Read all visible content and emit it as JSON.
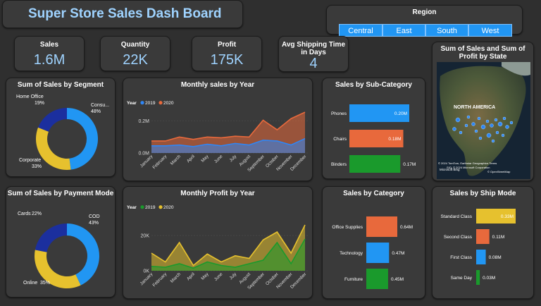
{
  "header": {
    "title": "Super Store Sales Dash Board"
  },
  "region": {
    "title": "Region",
    "options": [
      "Central",
      "East",
      "South",
      "West"
    ]
  },
  "kpis": [
    {
      "label": "Sales",
      "value": "1.6M"
    },
    {
      "label": "Quantity",
      "value": "22K"
    },
    {
      "label": "Profit",
      "value": "175K"
    },
    {
      "label": "Avg Shipping Time in Days",
      "value": "4"
    }
  ],
  "map": {
    "title": "Sum of Sales and Sum of Profit by State",
    "region_label": "NORTH AMERICA",
    "credit1": "© 2024 TomTom, Earthstar Geographics  Terms",
    "credit2": "SIO, © 2024 Microsoft Corporation",
    "credit3": "© OpenStreetMap",
    "brand": "Microsoft Bing"
  },
  "colors": {
    "blue": "#2196f3",
    "orange": "#e8693c",
    "green": "#1a9a2c",
    "yellow": "#e6c12e",
    "navy": "#1b2f9e",
    "y2019": "#2f86f5",
    "y2020": "#e8693c"
  },
  "chart_data": [
    {
      "id": "segment",
      "type": "pie",
      "title": "Sum of Sales by Segment",
      "slices": [
        {
          "label": "Consu...",
          "pct": "48%",
          "value": 48,
          "color": "#2196f3"
        },
        {
          "label": "Corporate",
          "pct": "33%",
          "value": 33,
          "color": "#e6c12e"
        },
        {
          "label": "Home Office",
          "pct": "19%",
          "value": 19,
          "color": "#1b2f9e"
        }
      ]
    },
    {
      "id": "payment",
      "type": "pie",
      "title": "Sum of Sales by Payment Mode",
      "slices": [
        {
          "label": "COD",
          "pct": "43%",
          "value": 43,
          "color": "#2196f3"
        },
        {
          "label": "Online",
          "pct": "35%",
          "value": 35,
          "color": "#e6c12e"
        },
        {
          "label": "Cards",
          "pct": "22%",
          "value": 22,
          "color": "#1b2f9e"
        }
      ]
    },
    {
      "id": "monthly_sales",
      "type": "area",
      "title": "Monthly sales by Year",
      "legend_title": "Year",
      "categories": [
        "January",
        "February",
        "March",
        "April",
        "May",
        "June",
        "July",
        "August",
        "September",
        "October",
        "November",
        "December"
      ],
      "yticks": [
        "0.0M",
        "0.2M"
      ],
      "ylim": [
        0,
        0.26
      ],
      "series": [
        {
          "name": "2019",
          "color": "#2f86f5",
          "values": [
            0.045,
            0.045,
            0.05,
            0.04,
            0.055,
            0.045,
            0.06,
            0.05,
            0.08,
            0.075,
            0.05,
            0.09
          ]
        },
        {
          "name": "2020",
          "color": "#e8693c",
          "values": [
            0.075,
            0.075,
            0.1,
            0.085,
            0.1,
            0.095,
            0.105,
            0.1,
            0.205,
            0.145,
            0.215,
            0.255
          ]
        }
      ]
    },
    {
      "id": "monthly_profit",
      "type": "area",
      "title": "Monthly Profit by Year",
      "legend_title": "Year",
      "categories": [
        "January",
        "February",
        "March",
        "April",
        "May",
        "June",
        "July",
        "August",
        "September",
        "October",
        "November",
        "December"
      ],
      "yticks": [
        "0K",
        "20K"
      ],
      "ylim": [
        0,
        30000
      ],
      "series": [
        {
          "name": "2019",
          "color": "#1a9a2c",
          "values": [
            2500,
            2000,
            4000,
            1500,
            5000,
            3000,
            2000,
            4000,
            6000,
            16000,
            4000,
            18000
          ]
        },
        {
          "name": "2020",
          "color": "#e6c12e",
          "values": [
            10000,
            5000,
            16000,
            3000,
            9500,
            5000,
            8500,
            7000,
            17500,
            22000,
            10000,
            26000
          ]
        }
      ]
    },
    {
      "id": "subcat",
      "type": "bar",
      "title": "Sales by Sub-Category",
      "categories": [
        "Phones",
        "Chairs",
        "Binders"
      ],
      "values": [
        0.2,
        0.18,
        0.17
      ],
      "labels": [
        "0.20M",
        "0.18M",
        "0.17M"
      ],
      "colors": [
        "#2196f3",
        "#e8693c",
        "#1a9a2c"
      ]
    },
    {
      "id": "category",
      "type": "bar",
      "title": "Sales by Category",
      "categories": [
        "Office Supplies",
        "Technology",
        "Furniture"
      ],
      "values": [
        0.64,
        0.47,
        0.45
      ],
      "labels": [
        "0.64M",
        "0.47M",
        "0.45M"
      ],
      "colors": [
        "#e8693c",
        "#2196f3",
        "#1a9a2c"
      ]
    },
    {
      "id": "shipmode",
      "type": "bar",
      "title": "Sales by Ship Mode",
      "categories": [
        "Standard Class",
        "Second Class",
        "First Class",
        "Same Day"
      ],
      "values": [
        0.33,
        0.11,
        0.08,
        0.03
      ],
      "labels": [
        "0.33M",
        "0.11M",
        "0.08M",
        "0.03M"
      ],
      "colors": [
        "#e6c12e",
        "#e8693c",
        "#2196f3",
        "#1a9a2c"
      ]
    }
  ]
}
